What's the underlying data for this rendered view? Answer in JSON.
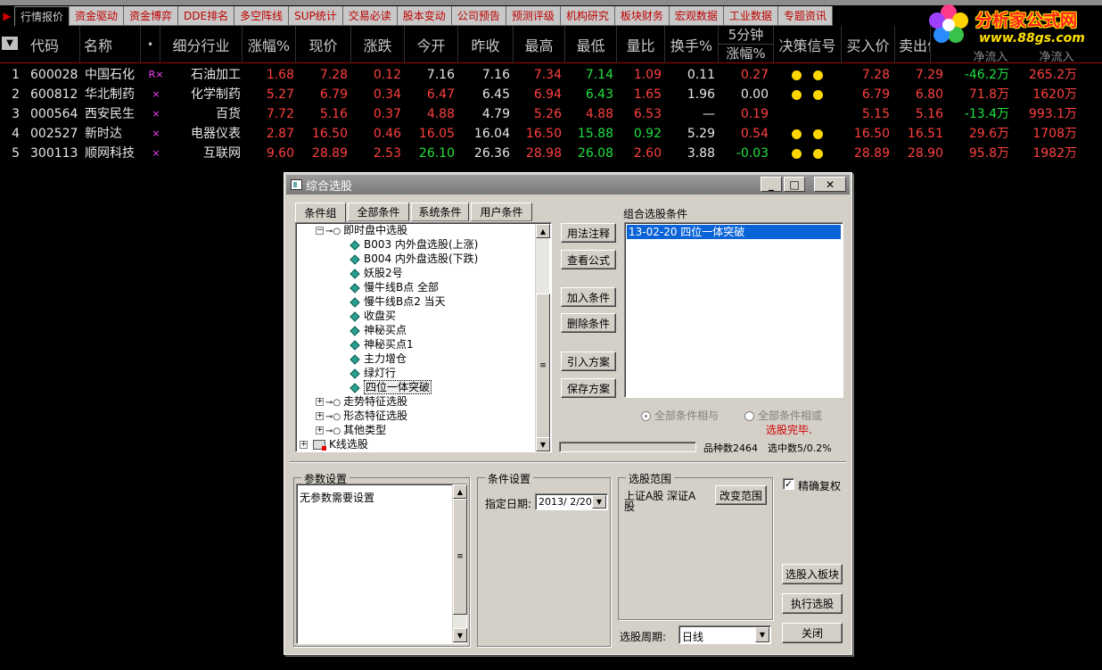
{
  "tabs": [
    "行情报价",
    "资金驱动",
    "资金博弈",
    "DDE排名",
    "多空阵线",
    "SUP统计",
    "交易必读",
    "股本变动",
    "公司预告",
    "预测评级",
    "机构研究",
    "板块财务",
    "宏观数据",
    "工业数据",
    "专题资讯"
  ],
  "logo": {
    "name": "分析家公式网",
    "url": "www.88gs.com"
  },
  "columns": {
    "code": "代码",
    "name": "名称",
    "dot": "•",
    "industry": "细分行业",
    "change_pct": "涨幅%",
    "price": "现价",
    "change": "涨跌",
    "open": "今开",
    "prev_close": "昨收",
    "high": "最高",
    "low": "最低",
    "vol_ratio": "量比",
    "turnover": "换手%",
    "five_min_top": "5分钟",
    "five_min_bottom": "涨幅%",
    "signal": "决策信号",
    "bid": "买入价",
    "ask": "卖出价",
    "net_inflow_1": "净流入",
    "net_inflow_2": "净流入"
  },
  "rows": [
    {
      "idx": "1",
      "code": "600028",
      "name": "中国石化",
      "flag": "R×",
      "industry": "石油加工",
      "change_pct": "1.68",
      "price": "7.28",
      "change": "0.12",
      "open": "7.16",
      "prev_close": "7.16",
      "high": "7.34",
      "low": "7.14",
      "vol_ratio": "1.09",
      "turnover": "0.11",
      "five_min": "0.27",
      "signal_dots": 2,
      "bid": "7.28",
      "ask": "7.29",
      "inflow_1": "-46.2万",
      "inflow_2": "265.2万"
    },
    {
      "idx": "2",
      "code": "600812",
      "name": "华北制药",
      "flag": "×",
      "industry": "化学制药",
      "change_pct": "5.27",
      "price": "6.79",
      "change": "0.34",
      "open": "6.47",
      "prev_close": "6.45",
      "high": "6.94",
      "low": "6.43",
      "vol_ratio": "1.65",
      "turnover": "1.96",
      "five_min": "0.00",
      "signal_dots": 2,
      "bid": "6.79",
      "ask": "6.80",
      "inflow_1": "71.8万",
      "inflow_2": "1620万"
    },
    {
      "idx": "3",
      "code": "000564",
      "name": "西安民生",
      "flag": "×",
      "industry": "百货",
      "change_pct": "7.72",
      "price": "5.16",
      "change": "0.37",
      "open": "4.88",
      "prev_close": "4.79",
      "high": "5.26",
      "low": "4.88",
      "vol_ratio": "6.53",
      "turnover": "—",
      "five_min": "0.19",
      "signal_dots": 0,
      "bid": "5.15",
      "ask": "5.16",
      "inflow_1": "-13.4万",
      "inflow_2": "993.1万"
    },
    {
      "idx": "4",
      "code": "002527",
      "name": "新时达",
      "flag": "×",
      "industry": "电器仪表",
      "change_pct": "2.87",
      "price": "16.50",
      "change": "0.46",
      "open": "16.05",
      "prev_close": "16.04",
      "high": "16.50",
      "low": "15.88",
      "vol_ratio": "0.92",
      "turnover": "5.29",
      "five_min": "0.54",
      "signal_dots": 2,
      "bid": "16.50",
      "ask": "16.51",
      "inflow_1": "29.6万",
      "inflow_2": "1708万"
    },
    {
      "idx": "5",
      "code": "300113",
      "name": "顺网科技",
      "flag": "×",
      "industry": "互联网",
      "change_pct": "9.60",
      "price": "28.89",
      "change": "2.53",
      "open": "26.10",
      "prev_close": "26.36",
      "high": "28.98",
      "low": "26.08",
      "vol_ratio": "2.60",
      "turnover": "3.88",
      "five_min": "-0.03",
      "signal_dots": 2,
      "bid": "28.89",
      "ask": "28.90",
      "inflow_1": "95.8万",
      "inflow_2": "1982万"
    }
  ],
  "dialog": {
    "title": "综合选股",
    "subtabs": [
      "条件组",
      "全部条件",
      "系统条件",
      "用户条件"
    ],
    "tree": [
      {
        "kind": "group",
        "label": "即时盘中选股",
        "expanded": true
      },
      {
        "kind": "leaf",
        "label": "B003 内外盘选股(上涨)"
      },
      {
        "kind": "leaf",
        "label": "B004 内外盘选股(下跌)"
      },
      {
        "kind": "leaf",
        "label": "妖股2号"
      },
      {
        "kind": "leaf",
        "label": "慢牛线B点 全部"
      },
      {
        "kind": "leaf",
        "label": "慢牛线B点2 当天"
      },
      {
        "kind": "leaf",
        "label": "收盘买"
      },
      {
        "kind": "leaf",
        "label": "神秘买点"
      },
      {
        "kind": "leaf",
        "label": "神秘买点1"
      },
      {
        "kind": "leaf",
        "label": "主力增仓"
      },
      {
        "kind": "leaf",
        "label": "绿灯行"
      },
      {
        "kind": "leaf",
        "label": "四位一体突破",
        "selected": true
      },
      {
        "kind": "group",
        "label": "走势特征选股"
      },
      {
        "kind": "group",
        "label": "形态特征选股"
      },
      {
        "kind": "group",
        "label": "其他类型"
      },
      {
        "kind": "root",
        "label": "K线选股"
      }
    ],
    "buttons": {
      "usage": "用法注释",
      "view_formula": "查看公式",
      "add": "加入条件",
      "delete": "删除条件",
      "import": "引入方案",
      "save": "保存方案",
      "to_block": "选股入板块",
      "run": "执行选股",
      "close": "关闭",
      "change_range": "改变范围"
    },
    "combo_title": "组合选股条件",
    "combo_items": [
      "13-02-20 四位一体突破"
    ],
    "radio_and": "全部条件相与",
    "radio_or": "全部条件相或",
    "status": "选股完毕.",
    "stock_count": "品种数2464",
    "selected_count": "选中数5/0.2%",
    "param_title": "参数设置",
    "param_text": "无参数需要设置",
    "cond_title": "条件设置",
    "date_label": "指定日期:",
    "date_value": "2013/ 2/20",
    "range_title": "选股范围",
    "range_text": "上证A股 深证A股",
    "exact_label": "精确复权",
    "exact_checked": true,
    "period_label": "选股周期:",
    "period_value": "日线"
  }
}
